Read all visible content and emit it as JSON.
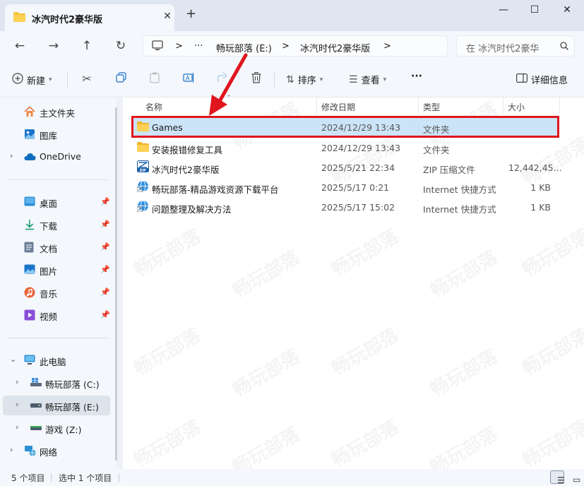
{
  "tab": {
    "title": "冰汽时代2豪华版",
    "close": "✕",
    "new_tab": "+"
  },
  "window": {
    "minimize": "—",
    "maximize": "☐",
    "close": "✕"
  },
  "address": {
    "computer_chevron": ">",
    "more": "···",
    "crumbs": [
      "畅玩部落 (E:)",
      "冰汽时代2豪华版"
    ],
    "sep": ">",
    "search_placeholder": "在 冰汽时代2豪华"
  },
  "toolbar": {
    "new_label": "新建",
    "sort_label": "排序",
    "view_label": "查看",
    "more": "···",
    "details_label": "详细信息"
  },
  "sidebar": {
    "quick": [
      {
        "label": "主文件夹",
        "icon": "home-icon"
      },
      {
        "label": "图库",
        "icon": "gallery-icon"
      },
      {
        "label": "OneDrive",
        "icon": "onedrive-icon"
      }
    ],
    "pinned": [
      {
        "label": "桌面",
        "icon": "desktop-icon"
      },
      {
        "label": "下载",
        "icon": "download-icon"
      },
      {
        "label": "文档",
        "icon": "document-icon"
      },
      {
        "label": "图片",
        "icon": "pictures-icon"
      },
      {
        "label": "音乐",
        "icon": "music-icon"
      },
      {
        "label": "视频",
        "icon": "video-icon"
      }
    ],
    "pc": {
      "label": "此电脑"
    },
    "drives": [
      {
        "label": "畅玩部落 (C:)"
      },
      {
        "label": "畅玩部落 (E:)"
      },
      {
        "label": "游戏 (Z:)"
      }
    ],
    "network": {
      "label": "网络"
    }
  },
  "columns": {
    "name": "名称",
    "modified": "修改日期",
    "type": "类型",
    "size": "大小"
  },
  "files": [
    {
      "name": "Games",
      "modified": "2024/12/29 13:43",
      "type": "文件夹",
      "size": "",
      "icon": "folder-icon"
    },
    {
      "name": "安装报错修复工具",
      "modified": "2024/12/29 13:43",
      "type": "文件夹",
      "size": "",
      "icon": "folder-icon"
    },
    {
      "name": "冰汽时代2豪华版",
      "modified": "2025/5/21 22:34",
      "type": "ZIP 压缩文件",
      "size": "12,442,45...",
      "icon": "zip-icon"
    },
    {
      "name": "畅玩部落-精品游戏资源下载平台",
      "modified": "2025/5/17 0:21",
      "type": "Internet 快捷方式",
      "size": "1 KB",
      "icon": "internet-shortcut-icon"
    },
    {
      "name": "问题整理及解决方法",
      "modified": "2025/5/17 15:02",
      "type": "Internet 快捷方式",
      "size": "1 KB",
      "icon": "internet-shortcut-icon"
    }
  ],
  "status": {
    "count": "5 个项目",
    "selected": "选中 1 个项目"
  },
  "watermark": "畅玩部落",
  "colors": {
    "accent": "#0067c0",
    "highlight_border": "#e0151e",
    "selection": "#cce4f7",
    "folder": "#f8c33c"
  }
}
